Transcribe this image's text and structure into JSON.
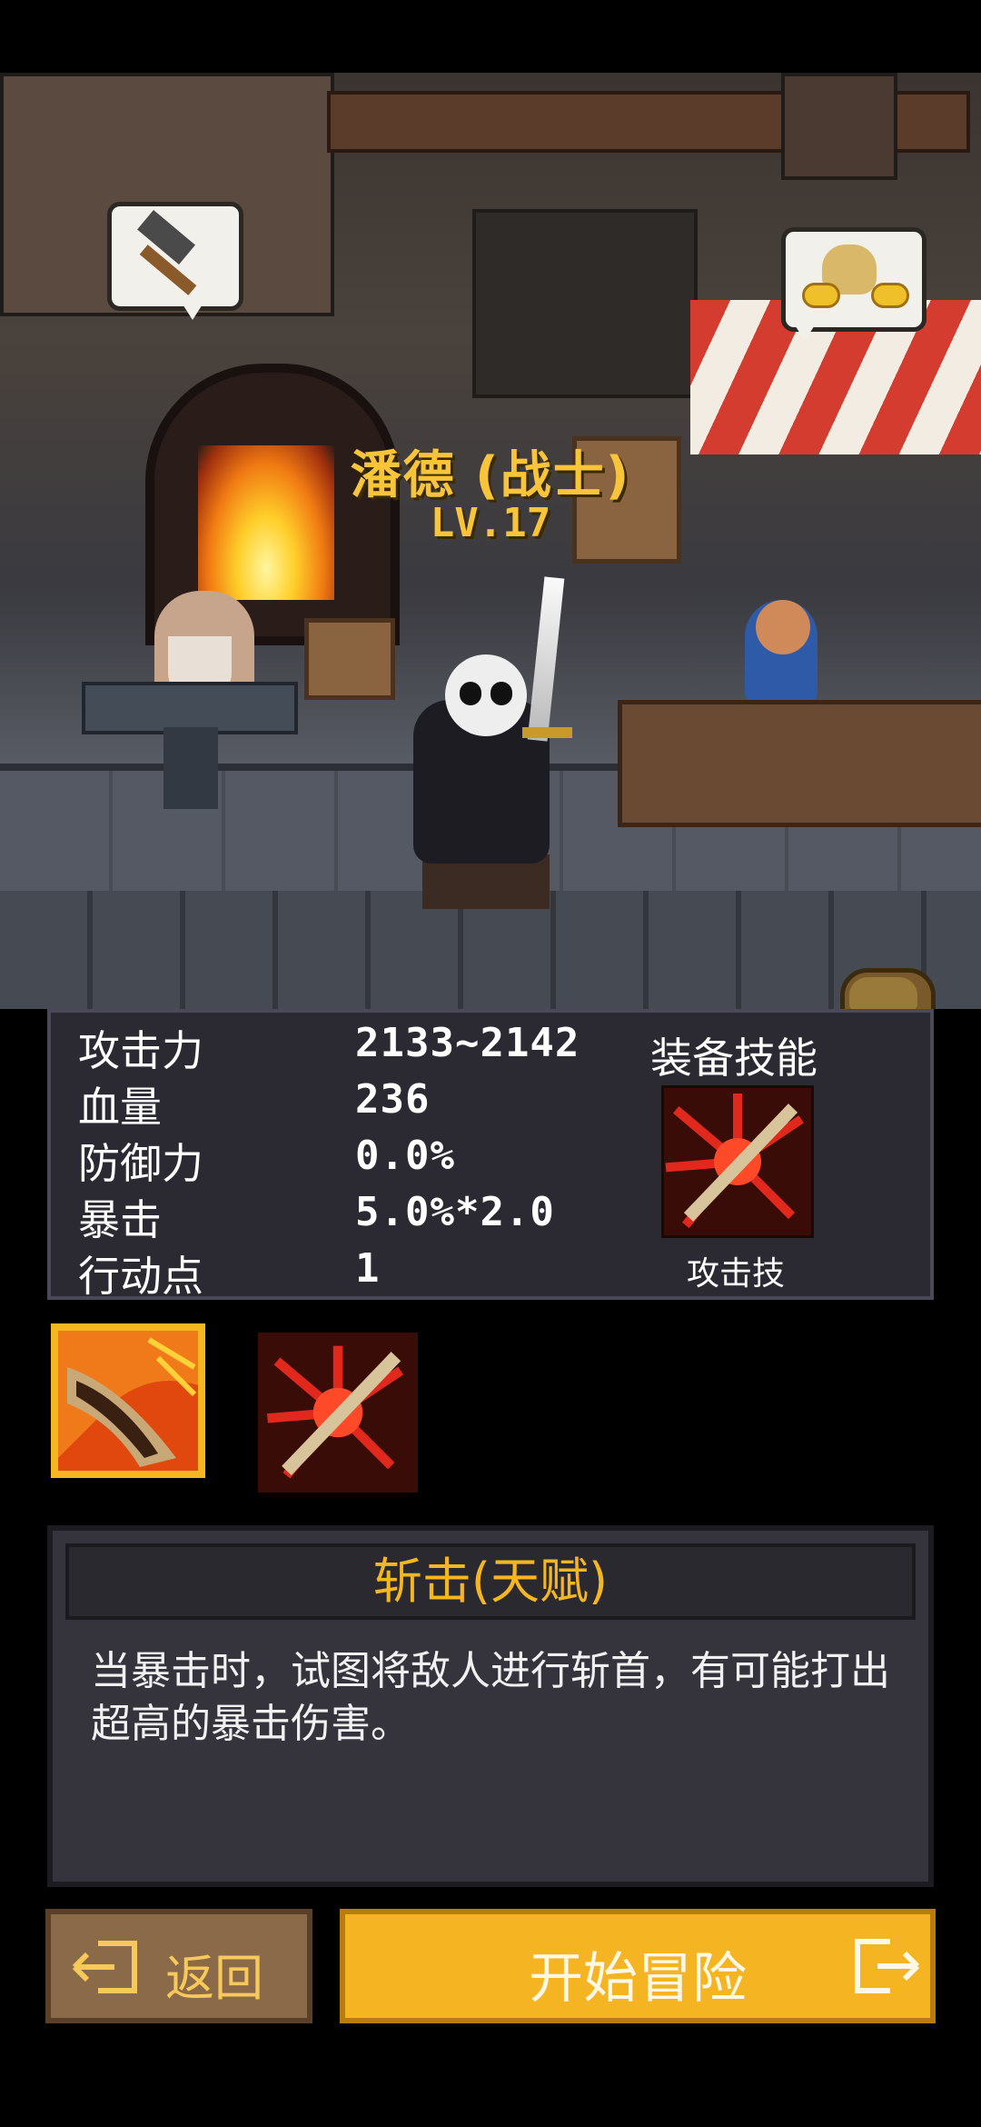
{
  "hero": {
    "name": "潘德 (战士)",
    "level": "LV.17"
  },
  "stats": {
    "rows": [
      {
        "label": "攻击力",
        "value": "2133~2142"
      },
      {
        "label": "血量",
        "value": "236"
      },
      {
        "label": "防御力",
        "value": "0.0%"
      },
      {
        "label": "暴击",
        "value": "5.0%*2.0"
      },
      {
        "label": "行动点",
        "value": "1"
      }
    ],
    "equipped_skill_header": "装备技能",
    "equipped_skill_name": "攻击技"
  },
  "skill_list": {
    "selected_index": 0
  },
  "description": {
    "title": "斩击(天赋)",
    "text": "当暴击时，试图将敌人进行斩首，有可能打出超高的暴击伤害。"
  },
  "buttons": {
    "back": "返回",
    "start": "开始冒险"
  },
  "colors": {
    "accent_gold": "#f5b71f",
    "panel_bg": "#2b2a33",
    "back_button": "#8a6a48"
  },
  "icons": {
    "blacksmith_bubble": "hammer-icon",
    "merchant_bubble": "gold-bag-icon",
    "inventory": "backpack-icon",
    "back_button": "exit-left-icon",
    "start_button": "exit-right-icon"
  }
}
